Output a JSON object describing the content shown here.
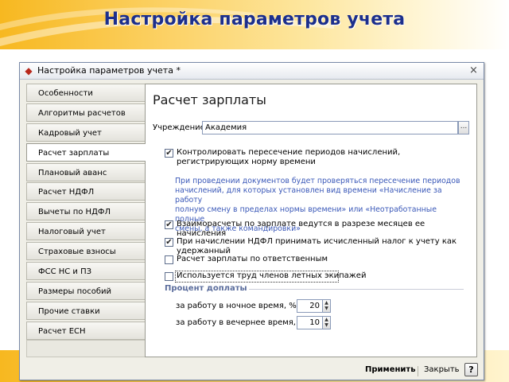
{
  "slide": {
    "title": "Настройка параметров учета"
  },
  "window": {
    "title": "Настройка параметров учета *",
    "close_glyph": "×"
  },
  "tabs": [
    {
      "label": "Особенности учреждения",
      "active": false
    },
    {
      "label": "Алгоритмы расчетов",
      "active": false
    },
    {
      "label": "Кадровый учет",
      "active": false
    },
    {
      "label": "Расчет зарплаты",
      "active": true
    },
    {
      "label": "Плановый аванс",
      "active": false
    },
    {
      "label": "Расчет НДФЛ",
      "active": false
    },
    {
      "label": "Вычеты по НДФЛ",
      "active": false
    },
    {
      "label": "Налоговый учет",
      "active": false
    },
    {
      "label": "Страховые взносы",
      "active": false
    },
    {
      "label": "ФСС НС и ПЗ",
      "active": false
    },
    {
      "label": "Размеры пособий",
      "active": false
    },
    {
      "label": "Прочие ставки",
      "active": false
    },
    {
      "label": "Расчет ЕСН",
      "active": false
    }
  ],
  "panel": {
    "title": "Расчет зарплаты",
    "org_label": "Учреждение:",
    "org_value": "Академия",
    "org_button": "...",
    "checkboxes": [
      {
        "line1": "Контролировать пересечение периодов начислений,",
        "line2": "регистрирующих норму времени",
        "checked": true
      },
      {
        "line1": "Взаиморасчеты по зарплате ведутся в разрезе месяцев ее начисления",
        "checked": true
      },
      {
        "line1": "При начислении НДФЛ принимать исчисленный налог к учету как удержанный",
        "checked": true
      },
      {
        "line1": "Расчет зарплаты по ответственным",
        "checked": false
      },
      {
        "line1": "Используется труд членов летных экипажей",
        "checked": false
      }
    ],
    "note": [
      "При проведении документов будет проверяться пересечение периодов",
      "начислений, для которых установлен вид времени «Начисление за работу",
      "полную смену в пределах нормы времени» или «Неотработанные полные",
      "смены, а также командировки»"
    ],
    "section_title": "Процент доплаты",
    "night_label": "за работу в ночное время, %:",
    "night_value": "20",
    "evening_label": "за работу в вечернее время, %:",
    "evening_value": "10"
  },
  "footer": {
    "apply_label": "Применить",
    "close_label": "Закрыть",
    "help_label": "?"
  },
  "colors": {
    "accent_title": "#1c2f8c",
    "note_text": "#3a58b8",
    "banner": "#f7b820"
  }
}
